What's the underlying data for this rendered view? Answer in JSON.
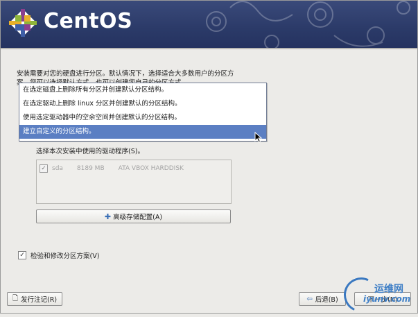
{
  "header": {
    "brand": "CentOS",
    "colors": {
      "banner": "#2b3a68",
      "logo_purple": "#8c3f8e",
      "logo_green": "#8fb53a",
      "logo_yellow": "#e9b02b",
      "logo_blue": "#3f5fa8"
    }
  },
  "intro_text": "安装需要对您的硬盘进行分区。默认情况下，选择适合大多数用户的分区方案。您可以选择默认方式，也可以创建您自己的分区方式。",
  "partition_dropdown": {
    "options": [
      "在选定磁盘上删除所有分区并创建默认分区结构。",
      "在选定驱动上删除 linux 分区并创建默认的分区结构。",
      "使用选定驱动器中的空余空间并创建默认的分区结构。",
      "建立自定义的分区结构。"
    ],
    "selected_index": 3,
    "highlight_color": "#5b7fc3"
  },
  "driver_label": "选择本次安装中使用的驱动程序(S)。",
  "disks": [
    {
      "checked": true,
      "name": "sda",
      "size": "8189 MB",
      "model": "ATA VBOX HARDDISK"
    }
  ],
  "advanced_button": {
    "label": "高级存储配置(A)",
    "icon": "plus-icon"
  },
  "review_checkbox": {
    "label": "检验和修改分区方案(V)",
    "checked": true
  },
  "footer": {
    "release_notes": "发行注记(R)",
    "back": "后退(B)",
    "next": "下一步(N)"
  },
  "watermark": {
    "line1": "运维网",
    "line2": "iyunv.com"
  }
}
